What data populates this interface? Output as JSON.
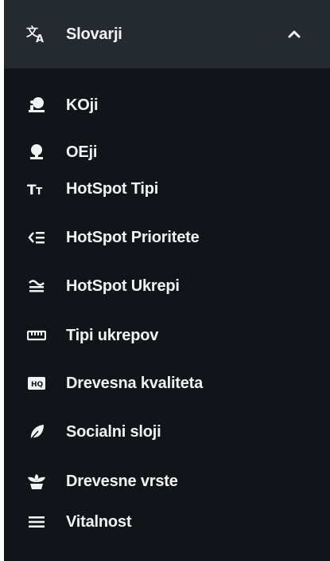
{
  "section": {
    "title": "Slovarji",
    "expanded": true,
    "icon": "translate-icon"
  },
  "items": [
    {
      "label": "KOji",
      "icon": "person-pin-icon"
    },
    {
      "label": "OEji",
      "icon": "pin-icon"
    },
    {
      "label": "HotSpot Tipi",
      "icon": "text-size-icon"
    },
    {
      "label": "HotSpot Prioritete",
      "icon": "priority-list-icon"
    },
    {
      "label": "HotSpot Ukrepi",
      "icon": "approx-equal-icon"
    },
    {
      "label": "Tipi ukrepov",
      "icon": "ruler-icon"
    },
    {
      "label": "Drevesna kvaliteta",
      "icon": "hq-badge-icon"
    },
    {
      "label": "Socialni sloji",
      "icon": "leaf-icon"
    },
    {
      "label": "Drevesne vrste",
      "icon": "seedling-icon"
    },
    {
      "label": "Vitalnost",
      "icon": "menu-lines-icon"
    }
  ],
  "colors": {
    "panel_bg": "#111418",
    "header_bg": "#242a30",
    "text": "#f2f2f2"
  }
}
